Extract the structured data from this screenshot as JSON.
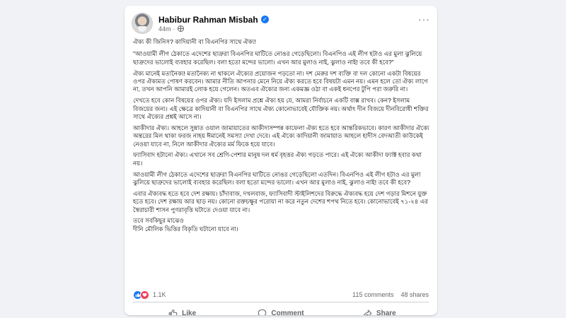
{
  "post": {
    "author": "Habibur Rahman Misbah",
    "time": "44m",
    "separator": "·",
    "paragraphs": [
      "ঐক্য কী জিনিস? কাদিয়ানী বা বিএনপির সাথে ঐক্য!",
      "\"আওয়ামী লীগ ঠেকাতে এদেশের ছাত্রুরা বিএনপির ঘাটিতে নোঙর গেড়েছিলো। বিএনপিও এই লীগ হটাও এর মুলা ঝুলিয়ে ছাত্রুদের ভালোই ব্যবহার করেছিল। বলা হতো মন্দের ভালো। এখন আর মুলাও নাই, ঝুলাও নাই! তবে কী হবে?\"",
      "ঐক্য মানেই মতানৈক্য! মতানৈক্য না থাকলে ঐক্যের প্রয়োজন পড়তো না। দশ মেরুর দশ ব্যক্তি বা দল কোনো একটা বিষয়ের ওপর ঐক্যমত পোষণ করবেন। আমার নীতি আপনার মেনে নিয়ে ঐক্য করতে হবে বিষয়টা এমন নয়। এমন হলে তো ঐক্য লাগে না, তখন আপনি আমারই লোক হয়ে গেলেন। অতএব ঐক্যের জন্য একমজ্ঞ ওঠা বা একই ধনপের টুপি পরা জরুরি না।",
      "দেখতে হবে কোন বিষয়ের ওপর ঐক্য। যদি ইসলাম প্রশ্নে ঐক্য হয় যে, আমরা নির্বাচনে একটি বাক্স রাখব। কেন? ইসলাম বিজয়ের জন্য। এই ক্ষেত্রে কাদিয়ানী বা বিএনপির সাথে ঐক্য কোনোভাবেই যৌক্তিক নয়। অর্থাৎ দীন বিজয়ে দীনবিরোধী শক্তির সাথে ঐক্যের প্রশ্নই আসে না।",
      "আকীদার ঐক্য। আহলে সুন্নাত ওয়াল জামায়াতের আকীদাসম্পন্ন কাফেলা ঐক্য হতে হবে আন্তরিকভাবে। কারণ আকীদার ঐক্যে অন্তরের মিল থাকা ফরজ নাহয় ঈমানেই সমস্যা দেখা দেবে। এই ঐক্যে কাদিয়ানী জামায়াত আহলে হাদীস বেদআতী কাউকেই নেওয়া যাবে না, নিলে আকীদার ঐক্যের মর্ম ফিকে হয়ে যাবে।",
      "ফ্যাসিবাদ হটানো ঐক্য। এখানে সব শ্রেণি-পেশার মানুষ দল ধর্ম বৃহত্তর ঐক্য গড়তে পারে। এই ঐক্যে আকীদা ফ্যাক্ট হবার কথা নয়।",
      "আওয়ামী লীগ ঠেকাতে এদেশের ছাত্রুরা বিএনপির ঘাটিতে নোঙর গেড়েছিলো এতদিন। বিএনপিও এই লীগ হটাও এর মুলা ঝুলিয়ে ছাত্রুদের ভালোই ব্যবহার করেছিল। বলা হতো মন্দের ভালো। এখন আর মুলাও নাই, ঝুলাও নাই! তবে কী হবে?",
      "এবার ঐক্যবদ্ধ হতে হবে দেশ রক্ষায়। চাঁদাবাজ, দখলবাজ, ফ্যাসিবাদী স্টাইলিশদের বিরুদ্ধে ঐক্যবদ্ধ হয়ে দেশ গড়ার মিশনে যুক্ত হতে হবে। দেশ রক্ষায় আর ছাড় নয়। কোনো রক্তচক্ষুর পরোয়া না করে নতুন দেশের শপথ নিতে হবে। কোনোভাবেই ৭১-২৪ এর স্বৈরাচারী শাসন পুণরাবৃত্তি ঘটাতে দেওয়া যাবে না।",
      "তবে সবকিছুর মাঝেও\nদীনি মৌলিক ভিত্তির বিকৃতি ঘটানো যাবে না।"
    ]
  },
  "reactions": {
    "count": "1.1K",
    "comments": "115 comments",
    "shares": "48 shares"
  },
  "actions": {
    "like": "Like",
    "comment": "Comment",
    "share": "Share"
  },
  "colors": {
    "brand": "#1877f2",
    "love": "#f33e58",
    "muted": "#65676b"
  }
}
